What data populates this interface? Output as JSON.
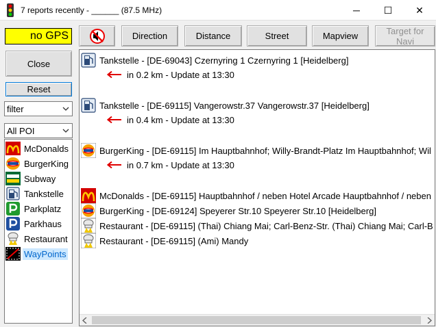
{
  "window": {
    "title": "7 reports recently - ______ (87.5 MHz)",
    "app_icon": "traffic-light-icon",
    "minimize": "─",
    "maximize": "☐",
    "close": "✕"
  },
  "gps_status": "no GPS",
  "toolbar": {
    "mute_icon": "speaker-muted-icon",
    "direction": "Direction",
    "distance": "Distance",
    "street": "Street",
    "mapview": "Mapview",
    "target_line1": "Target for",
    "target_line2": "Navi"
  },
  "sidebar": {
    "close": "Close",
    "reset": "Reset",
    "filter_value": "filter",
    "poi_value": "All POI",
    "poi_items": [
      {
        "label": "McDonalds",
        "icon": "mcdonalds-icon"
      },
      {
        "label": "BurgerKing",
        "icon": "burgerking-icon"
      },
      {
        "label": "Subway",
        "icon": "subway-icon"
      },
      {
        "label": "Tankstelle",
        "icon": "fuel-pump-icon"
      },
      {
        "label": "Parkplatz",
        "icon": "parking-icon"
      },
      {
        "label": "Parkhaus",
        "icon": "parking-garage-icon"
      },
      {
        "label": "Restaurant",
        "icon": "restaurant-icon"
      },
      {
        "label": "WayPoints",
        "icon": "waypoint-icon",
        "selected": true
      }
    ]
  },
  "results": [
    {
      "text": "Tankstelle - [DE-69043] Czernyring 1  Czernyring 1 [Heidelberg]",
      "icon": "fuel-pump-icon",
      "detail": "in 0.2 km - Update at 13:30"
    },
    {
      "text": "Tankstelle - [DE-69115] Vangerowstr.37  Vangerowstr.37 [Heidelberg]",
      "icon": "fuel-pump-icon",
      "detail": "in 0.4 km - Update at 13:30"
    },
    {
      "text": "BurgerKing - [DE-69115] Im Hauptbahnhof; Willy-Brandt-Platz  Im Hauptbahnhof; Wil",
      "icon": "burgerking-icon",
      "detail": "in 0.7 km - Update at 13:30"
    },
    {
      "text": "McDonalds - [DE-69115] Hauptbahnhof / neben Hotel Arcade  Hauptbahnhof / neben",
      "icon": "mcdonalds-icon"
    },
    {
      "text": "BurgerKing - [DE-69124] Speyerer Str.10  Speyerer Str.10 [Heidelberg]",
      "icon": "burgerking-icon"
    },
    {
      "text": "Restaurant - [DE-69115] (Thai) Chiang Mai; Carl-Benz-Str.  (Thai) Chiang Mai; Carl-B",
      "icon": "restaurant-icon"
    },
    {
      "text": "Restaurant - [DE-69115] (Ami) Mandy",
      "icon": "restaurant-icon"
    }
  ],
  "colors": {
    "gps_bg": "#ffff00",
    "arrow": "#e00000",
    "selection": "#cce8ff"
  }
}
